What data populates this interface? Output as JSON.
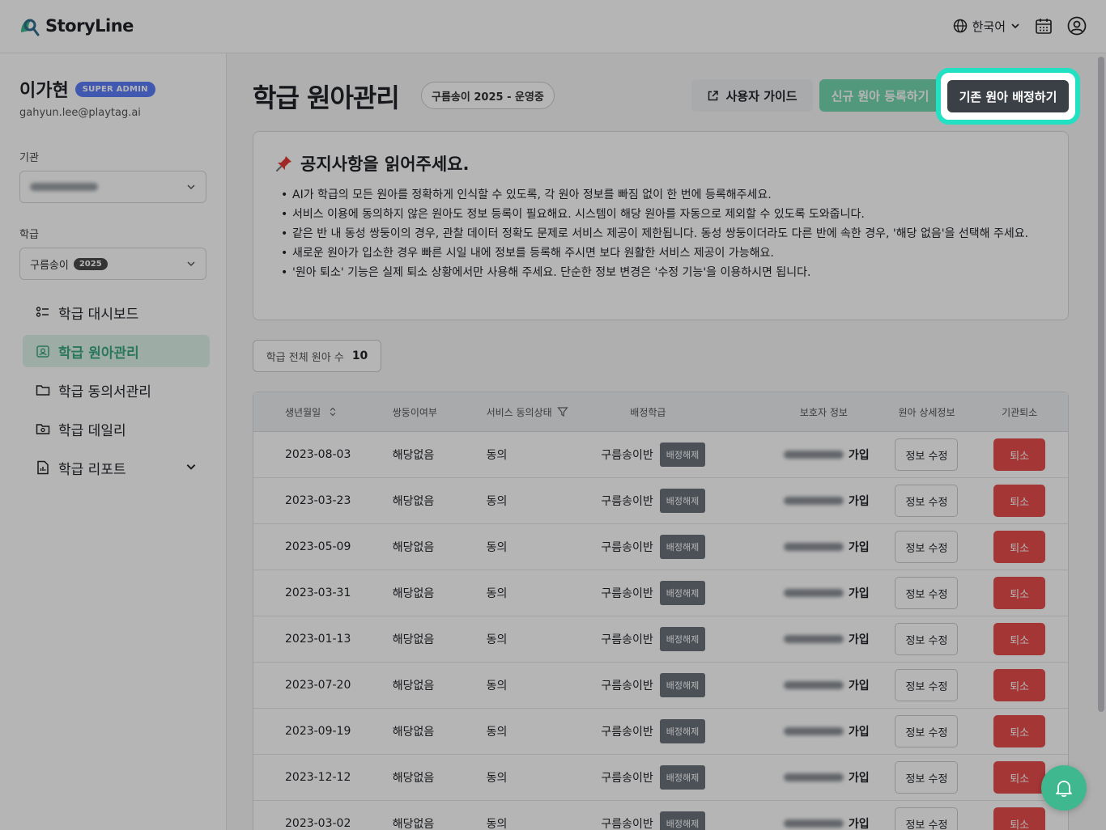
{
  "app": {
    "name": "StoryLine",
    "language": "한국어"
  },
  "user": {
    "name": "이가현",
    "role_badge": "SUPER ADMIN",
    "email": "gahyun.lee@playtag.ai"
  },
  "sidebar": {
    "org_label": "기관",
    "class_label": "학급",
    "class_select": {
      "value": "구름송이",
      "year": "2025"
    },
    "items": [
      {
        "label": "학급 대시보드",
        "icon": "dashboard-list-icon"
      },
      {
        "label": "학급 원아관리",
        "icon": "child-id-icon"
      },
      {
        "label": "학급 동의서관리",
        "icon": "folder-icon"
      },
      {
        "label": "학급 데일리",
        "icon": "photo-folder-icon"
      },
      {
        "label": "학급 리포트",
        "icon": "report-icon"
      }
    ]
  },
  "main": {
    "title": "학급 원아관리",
    "class_chip": "구름송이 2025 - 운영중",
    "buttons": {
      "guide": "사용자 가이드",
      "register_new": "신규 원아 등록하기",
      "assign_existing": "기존 원아 배정하기"
    },
    "notice": {
      "title": "공지사항을 읽어주세요.",
      "items": [
        "AI가 학급의 모든 원아를 정확하게 인식할 수 있도록, 각 원아 정보를 빠짐 없이 한 번에 등록해주세요.",
        "서비스 이용에 동의하지 않은 원아도 정보 등록이 필요해요. 시스템이 해당 원아를 자동으로 제외할 수 있도록 도와줍니다.",
        "같은 반 내 동성 쌍둥이의 경우, 관찰 데이터 정확도 문제로 서비스 제공이 제한됩니다. 동성 쌍둥이더라도 다른 반에 속한 경우, '해당 없음'을 선택해 주세요.",
        "새로운 원아가 입소한 경우 빠른 시일 내에 정보를 등록해 주시면 보다 원활한 서비스 제공이 가능해요.",
        "'원아 퇴소' 기능은 실제 퇴소 상황에서만 사용해 주세요. 단순한 정보 변경은 '수정 기능'을 이용하시면 됩니다."
      ]
    },
    "count": {
      "label": "학급 전체 원아 수",
      "value": "10"
    },
    "table": {
      "headers": [
        "생년월일",
        "쌍둥이여부",
        "서비스 동의상태",
        "배정학급",
        "보호자 정보",
        "원아 상세정보",
        "기관퇴소"
      ],
      "unassign_label": "배정해제",
      "edit_label": "정보 수정",
      "leave_label": "퇴소",
      "joined_label": "가입",
      "rows": [
        {
          "birth": "2023-08-03",
          "twin": "해당없음",
          "consent": "동의",
          "class": "구름송이반"
        },
        {
          "birth": "2023-03-23",
          "twin": "해당없음",
          "consent": "동의",
          "class": "구름송이반"
        },
        {
          "birth": "2023-05-09",
          "twin": "해당없음",
          "consent": "동의",
          "class": "구름송이반"
        },
        {
          "birth": "2023-03-31",
          "twin": "해당없음",
          "consent": "동의",
          "class": "구름송이반"
        },
        {
          "birth": "2023-01-13",
          "twin": "해당없음",
          "consent": "동의",
          "class": "구름송이반"
        },
        {
          "birth": "2023-07-20",
          "twin": "해당없음",
          "consent": "동의",
          "class": "구름송이반"
        },
        {
          "birth": "2023-09-19",
          "twin": "해당없음",
          "consent": "동의",
          "class": "구름송이반"
        },
        {
          "birth": "2023-12-12",
          "twin": "해당없음",
          "consent": "동의",
          "class": "구름송이반"
        },
        {
          "birth": "2023-03-02",
          "twin": "해당없음",
          "consent": "동의",
          "class": "구름송이반"
        }
      ]
    }
  },
  "colors": {
    "accent": "#3fb88f",
    "highlight": "#22e0c2",
    "danger": "#e74c4c",
    "dark_button": "#3b3f46"
  }
}
